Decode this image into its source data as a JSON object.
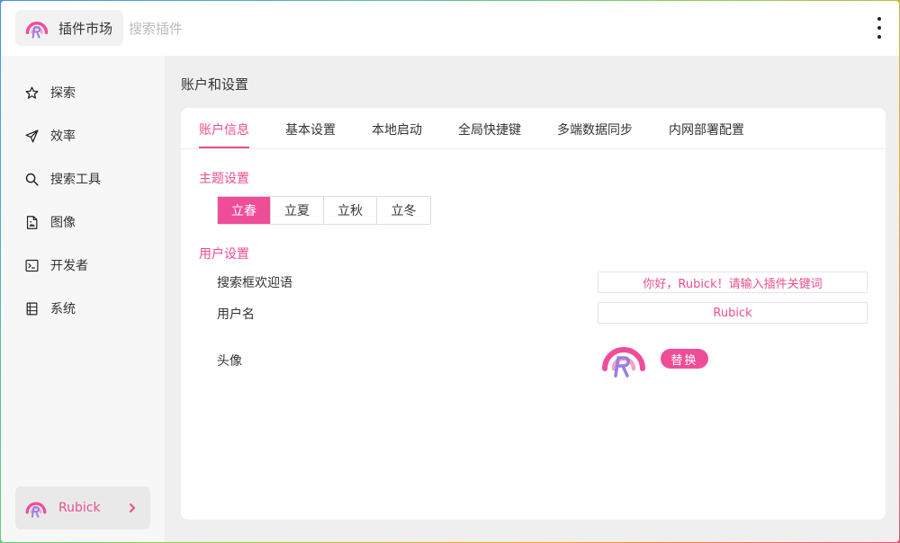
{
  "header": {
    "brand_label": "插件市场",
    "search_placeholder": "搜索插件",
    "more_icon": "more-vertical-icon"
  },
  "sidebar": {
    "items": [
      {
        "label": "探索",
        "icon": "star-icon"
      },
      {
        "label": "效率",
        "icon": "send-icon"
      },
      {
        "label": "搜索工具",
        "icon": "search-icon"
      },
      {
        "label": "图像",
        "icon": "image-file-icon"
      },
      {
        "label": "开发者",
        "icon": "terminal-icon"
      },
      {
        "label": "系统",
        "icon": "list-icon"
      }
    ],
    "user": {
      "name": "Rubick"
    }
  },
  "main": {
    "title": "账户和设置",
    "tabs": [
      {
        "label": "账户信息",
        "active": true
      },
      {
        "label": "基本设置"
      },
      {
        "label": "本地启动"
      },
      {
        "label": "全局快捷键"
      },
      {
        "label": "多端数据同步"
      },
      {
        "label": "内网部署配置"
      }
    ],
    "theme_section": {
      "title": "主题设置",
      "options": [
        "立春",
        "立夏",
        "立秋",
        "立冬"
      ],
      "selected": "立春"
    },
    "user_section": {
      "title": "用户设置",
      "greeting_label": "搜索框欢迎语",
      "greeting_value": "你好，Rubick！请输入插件关键词",
      "username_label": "用户名",
      "username_value": "Rubick",
      "avatar_label": "头像",
      "replace_label": "替换"
    }
  },
  "colors": {
    "accent": "#f04d99",
    "accent_text": "#e94f8d",
    "sidebar_bg": "#f7f7f7",
    "main_bg": "#efefef"
  }
}
